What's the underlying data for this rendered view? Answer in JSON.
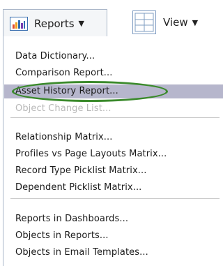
{
  "toolbar": {
    "reports_label": "Reports",
    "reports_caret": "▼",
    "view_label": "View",
    "view_caret": "▼"
  },
  "menu": {
    "group1": [
      {
        "label": "Data Dictionary...",
        "enabled": true
      },
      {
        "label": "Comparison Report...",
        "enabled": true
      },
      {
        "label": "Asset History Report...",
        "enabled": true,
        "highlighted": true
      },
      {
        "label": "Object Change List...",
        "enabled": false
      }
    ],
    "group2": [
      {
        "label": "Relationship Matrix...",
        "enabled": true
      },
      {
        "label": "Profiles vs Page Layouts Matrix...",
        "enabled": true
      },
      {
        "label": "Record Type Picklist Matrix...",
        "enabled": true
      },
      {
        "label": "Dependent Picklist Matrix...",
        "enabled": true
      }
    ],
    "group3": [
      {
        "label": "Reports in Dashboards...",
        "enabled": true
      },
      {
        "label": "Objects in Reports...",
        "enabled": true
      },
      {
        "label": "Objects in Email Templates...",
        "enabled": true
      }
    ]
  },
  "colors": {
    "highlight": "#b6b6cc",
    "annotation_ellipse": "#3b8a2c",
    "disabled_text": "#b8b8b8"
  }
}
